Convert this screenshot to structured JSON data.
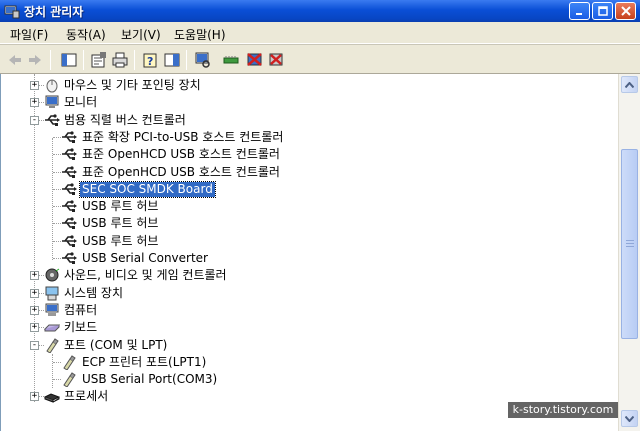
{
  "window": {
    "title": "장치 관리자"
  },
  "menu": [
    "파일(F)",
    "동작(A)",
    "보기(V)",
    "도움말(H)"
  ],
  "toolbar": {
    "buttons": [
      "back-icon",
      "forward-icon",
      "console-tree-icon",
      "properties-icon",
      "print-icon",
      "help-icon",
      "show-hide-icon",
      "scan-hardware-icon",
      "update-driver-icon",
      "disable-icon",
      "uninstall-icon"
    ]
  },
  "tree": {
    "items": [
      {
        "label": "마우스 및 기타 포인팅 장치",
        "level": 1,
        "expander": "+",
        "icon": "mouse-icon"
      },
      {
        "label": "모니터",
        "level": 1,
        "expander": "+",
        "icon": "monitor-icon"
      },
      {
        "label": "범용 직렬 버스 컨트롤러",
        "level": 1,
        "expander": "-",
        "icon": "usb-icon"
      },
      {
        "label": "표준 확장 PCI-to-USB 호스트 컨트롤러",
        "level": 2,
        "icon": "usb-icon"
      },
      {
        "label": "표준 OpenHCD USB 호스트 컨트롤러",
        "level": 2,
        "icon": "usb-icon"
      },
      {
        "label": "표준 OpenHCD USB 호스트 컨트롤러",
        "level": 2,
        "icon": "usb-icon"
      },
      {
        "label": "SEC SOC SMDK Board",
        "level": 2,
        "icon": "usb-icon",
        "selected": true
      },
      {
        "label": "USB 루트 허브",
        "level": 2,
        "icon": "usb-icon"
      },
      {
        "label": "USB 루트 허브",
        "level": 2,
        "icon": "usb-icon"
      },
      {
        "label": "USB 루트 허브",
        "level": 2,
        "icon": "usb-icon"
      },
      {
        "label": "USB Serial Converter",
        "level": 2,
        "icon": "usb-icon"
      },
      {
        "label": "사운드, 비디오 및 게임 컨트롤러",
        "level": 1,
        "expander": "+",
        "icon": "sound-icon"
      },
      {
        "label": "시스템 장치",
        "level": 1,
        "expander": "+",
        "icon": "system-icon"
      },
      {
        "label": "컴퓨터",
        "level": 1,
        "expander": "+",
        "icon": "computer-icon"
      },
      {
        "label": "키보드",
        "level": 1,
        "expander": "+",
        "icon": "keyboard-icon"
      },
      {
        "label": "포트 (COM 및 LPT)",
        "level": 1,
        "expander": "-",
        "icon": "port-icon"
      },
      {
        "label": "ECP 프린터 포트(LPT1)",
        "level": 2,
        "icon": "port-icon"
      },
      {
        "label": "USB Serial Port(COM3)",
        "level": 2,
        "icon": "port-icon"
      },
      {
        "label": "프로세서",
        "level": 1,
        "expander": "+",
        "icon": "processor-icon"
      }
    ]
  },
  "watermark": "k-story.tistory.com",
  "colors": {
    "title_bar": "#0a4fd6",
    "selection": "#316ac5",
    "window_bg": "#ece9d8"
  }
}
